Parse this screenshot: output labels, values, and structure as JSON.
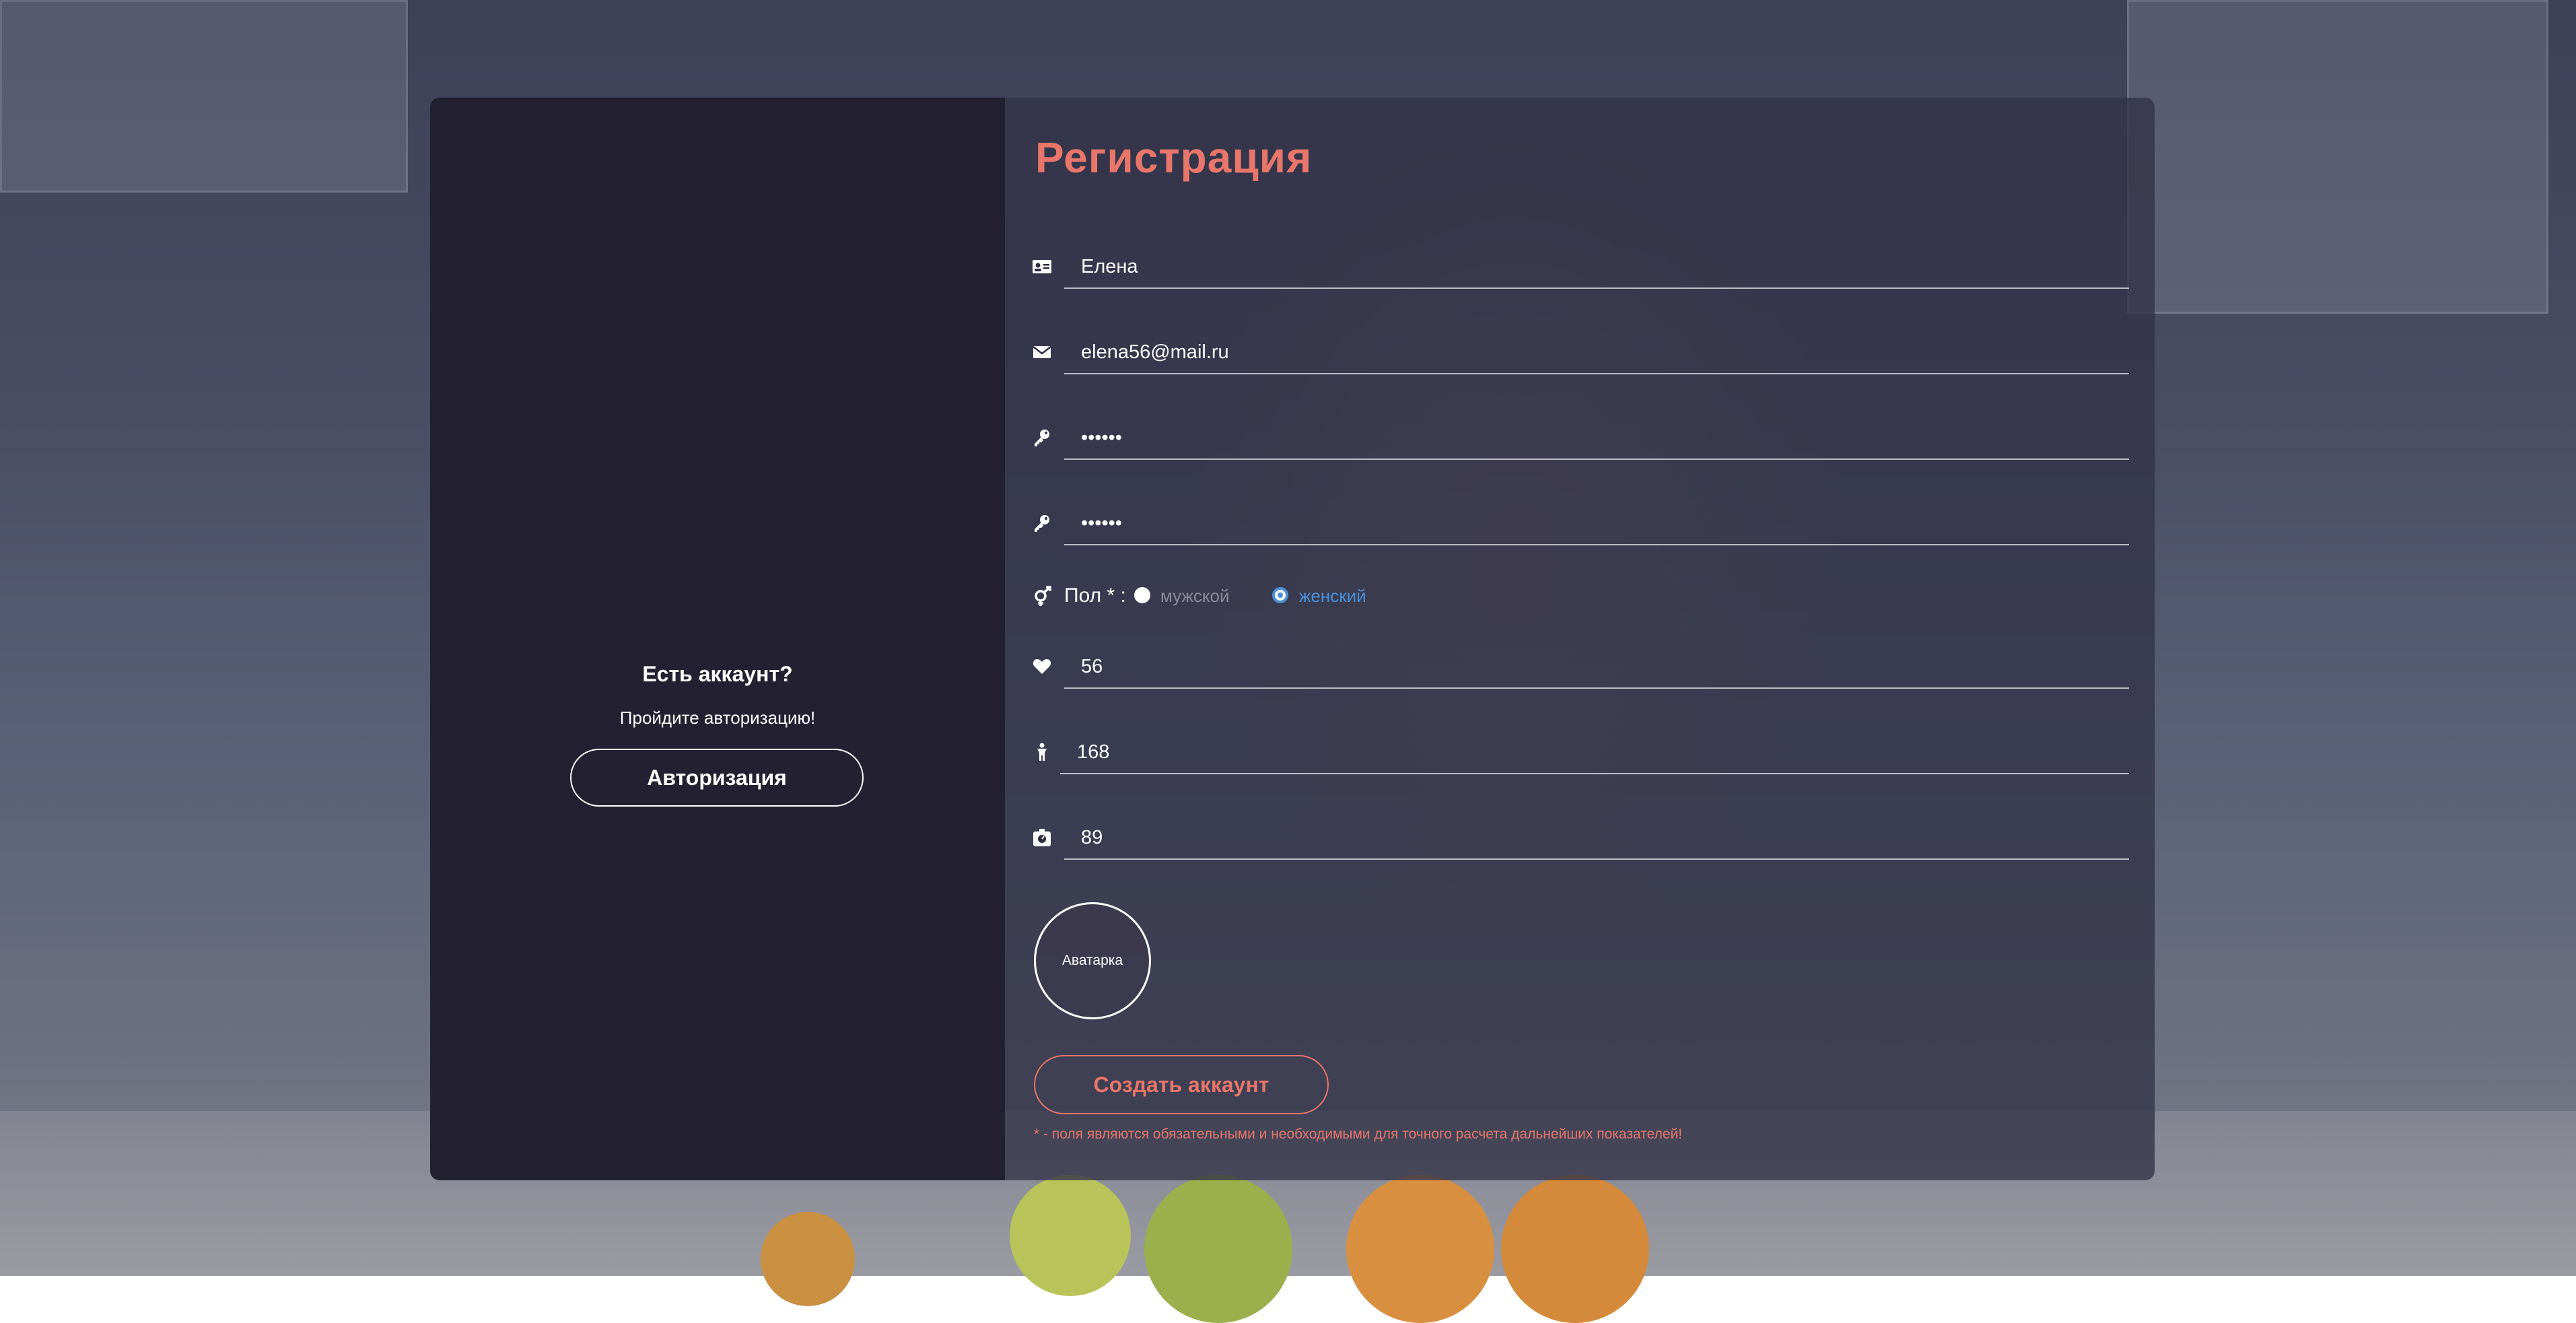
{
  "left": {
    "title": "Есть аккаунт?",
    "subtitle": "Пройдите авторизацию!",
    "auth_button": "Авторизация"
  },
  "form": {
    "title": "Регистрация",
    "name_value": "Елена",
    "email_value": "elena56@mail.ru",
    "password_value": "••••••",
    "password_confirm_value": "••••••",
    "gender_label": "Пол * :",
    "gender_options": [
      "мужской",
      "женский"
    ],
    "gender_selected": "женский",
    "age_value": "56",
    "height_value": "168",
    "weight_value": "89",
    "avatar_label": "Аватарка",
    "create_button": "Создать аккаунт",
    "footnote": "* - поля являются обязательными и необходимыми для точного расчета дальнейших показателей!"
  },
  "colors": {
    "accent": "#e8766a",
    "radio_selected": "#4a90d9",
    "left_panel": "#222031"
  },
  "icons": [
    "id-card-icon",
    "envelope-icon",
    "key-icon",
    "key-icon",
    "gender-icon",
    "heart-icon",
    "height-icon",
    "scale-icon"
  ]
}
